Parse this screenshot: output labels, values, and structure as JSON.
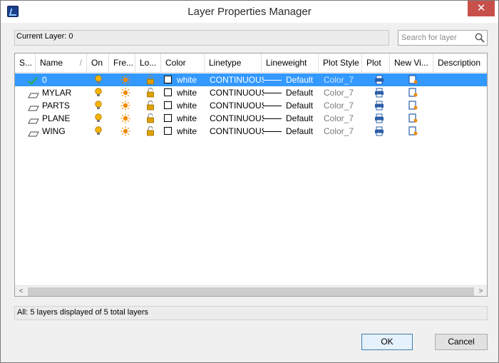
{
  "window": {
    "title": "Layer Properties Manager",
    "close_glyph": "✕"
  },
  "current_layer": {
    "label": "Current Layer: 0"
  },
  "search": {
    "placeholder": "Search for layer"
  },
  "columns": {
    "status": "S...",
    "name": "Name",
    "sort_glyph": "/",
    "on": "On",
    "freeze": "Fre...",
    "lock": "Lo...",
    "color": "Color",
    "linetype": "Linetype",
    "lineweight": "Lineweight",
    "plot_style": "Plot Style",
    "plot": "Plot",
    "new_vp": "New Vi...",
    "description": "Description"
  },
  "layers": [
    {
      "name": "0",
      "color": "white",
      "linetype": "CONTINUOUS",
      "lineweight": "Default",
      "plot_style": "Color_7",
      "current": true
    },
    {
      "name": "MYLAR",
      "color": "white",
      "linetype": "CONTINUOUS",
      "lineweight": "Default",
      "plot_style": "Color_7",
      "current": false
    },
    {
      "name": "PARTS",
      "color": "white",
      "linetype": "CONTINUOUS",
      "lineweight": "Default",
      "plot_style": "Color_7",
      "current": false
    },
    {
      "name": "PLANE",
      "color": "white",
      "linetype": "CONTINUOUS",
      "lineweight": "Default",
      "plot_style": "Color_7",
      "current": false
    },
    {
      "name": "WING",
      "color": "white",
      "linetype": "CONTINUOUS",
      "lineweight": "Default",
      "plot_style": "Color_7",
      "current": false
    }
  ],
  "scrollbar": {
    "left_glyph": "<",
    "right_glyph": ">"
  },
  "status": {
    "text": "All:  5 layers displayed of 5 total layers"
  },
  "buttons": {
    "ok": "OK",
    "cancel": "Cancel"
  },
  "colors": {
    "selection": "#3399ff",
    "bulb": "#f5b400",
    "sun": "#f08a00",
    "lock": "#e0a100",
    "printer": "#2a5ea8",
    "current_check": "#2eaa3c"
  },
  "icons": {
    "on": "lightbulb-on-icon",
    "freeze": "sun-thawed-icon",
    "lock": "unlocked-padlock-icon",
    "plot": "printer-icon",
    "new_vp": "new-viewport-freeze-icon",
    "status_current": "green-check-icon",
    "status_layer": "layer-sheet-icon"
  }
}
